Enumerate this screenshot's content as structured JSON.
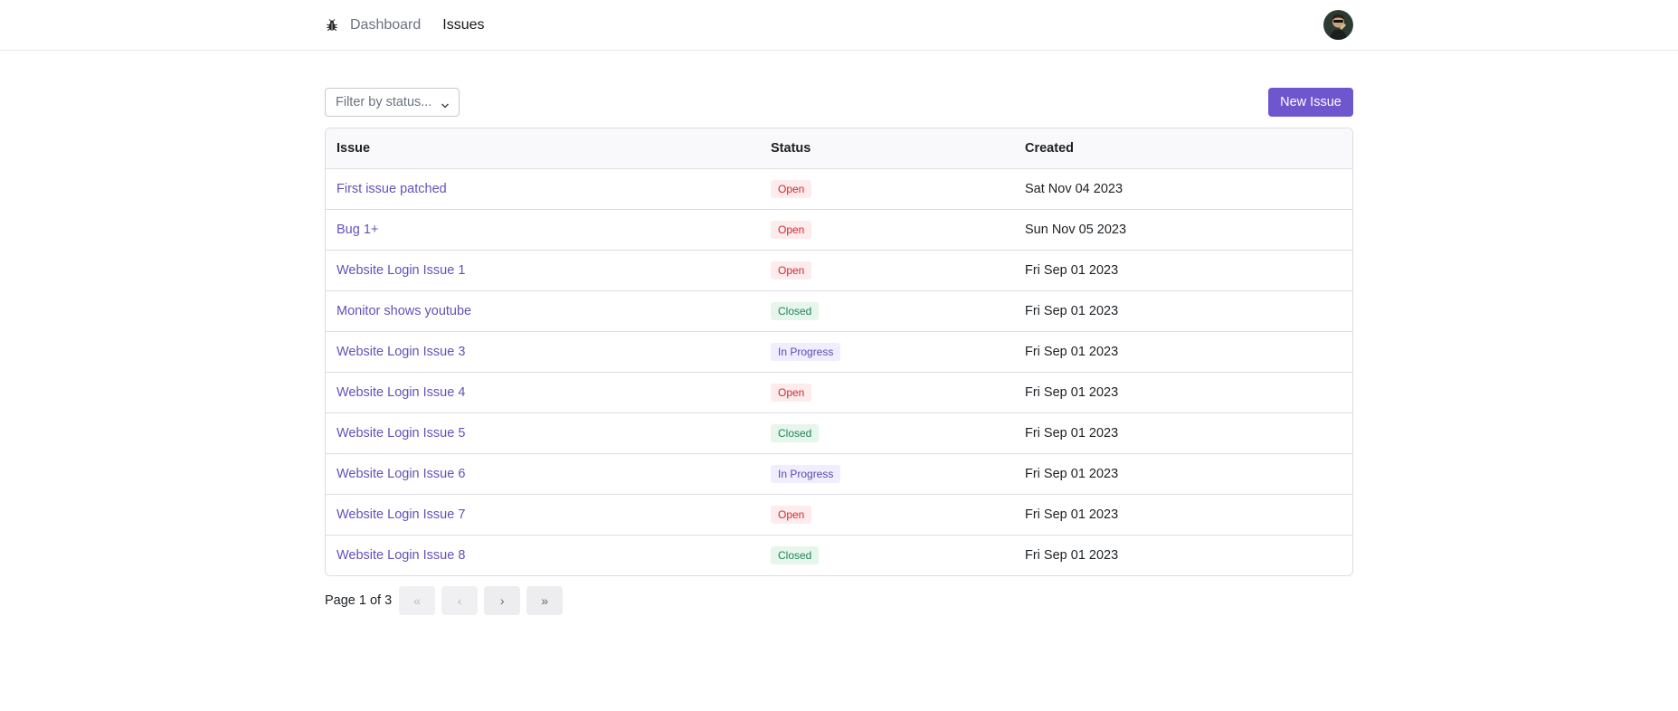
{
  "nav": {
    "logo_icon": "bug-icon",
    "links": [
      {
        "label": "Dashboard",
        "active": false
      },
      {
        "label": "Issues",
        "active": true
      }
    ],
    "avatar_icon": "user-avatar"
  },
  "toolbar": {
    "filter_placeholder": "Filter by status...",
    "new_issue_label": "New Issue"
  },
  "table": {
    "headers": [
      "Issue",
      "Status",
      "Created"
    ],
    "rows": [
      {
        "title": "First issue patched",
        "status": "Open",
        "status_kind": "open",
        "created": "Sat Nov 04 2023"
      },
      {
        "title": "Bug 1+",
        "status": "Open",
        "status_kind": "open",
        "created": "Sun Nov 05 2023"
      },
      {
        "title": "Website Login Issue 1",
        "status": "Open",
        "status_kind": "open",
        "created": "Fri Sep 01 2023"
      },
      {
        "title": "Monitor shows youtube",
        "status": "Closed",
        "status_kind": "closed",
        "created": "Fri Sep 01 2023"
      },
      {
        "title": "Website Login Issue 3",
        "status": "In Progress",
        "status_kind": "progress",
        "created": "Fri Sep 01 2023"
      },
      {
        "title": "Website Login Issue 4",
        "status": "Open",
        "status_kind": "open",
        "created": "Fri Sep 01 2023"
      },
      {
        "title": "Website Login Issue 5",
        "status": "Closed",
        "status_kind": "closed",
        "created": "Fri Sep 01 2023"
      },
      {
        "title": "Website Login Issue 6",
        "status": "In Progress",
        "status_kind": "progress",
        "created": "Fri Sep 01 2023"
      },
      {
        "title": "Website Login Issue 7",
        "status": "Open",
        "status_kind": "open",
        "created": "Fri Sep 01 2023"
      },
      {
        "title": "Website Login Issue 8",
        "status": "Closed",
        "status_kind": "closed",
        "created": "Fri Sep 01 2023"
      }
    ]
  },
  "pagination": {
    "label": "Page 1 of 3",
    "buttons": [
      {
        "icon": "double-chevron-left-icon",
        "glyph": "«",
        "enabled": false
      },
      {
        "icon": "chevron-left-icon",
        "glyph": "‹",
        "enabled": false
      },
      {
        "icon": "chevron-right-icon",
        "glyph": "›",
        "enabled": true
      },
      {
        "icon": "double-chevron-right-icon",
        "glyph": "»",
        "enabled": true
      }
    ]
  },
  "colors": {
    "accent": "#6e56cf",
    "link": "#6550b9",
    "open_bg": "#feebec",
    "open_fg": "#ce2c31",
    "closed_bg": "#e6f6eb",
    "closed_fg": "#218358",
    "progress_bg": "#f0eefe",
    "progress_fg": "#5b49b0"
  }
}
